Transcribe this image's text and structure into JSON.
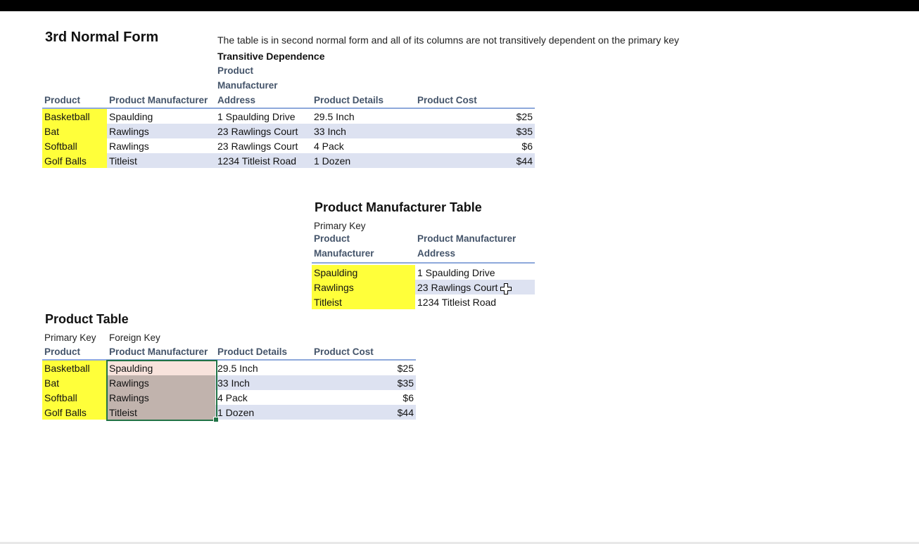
{
  "heading": {
    "title": "3rd Normal Form",
    "description": "The table is in second normal form and all of its columns are not transitively dependent on the primary key",
    "transitive_label": "Transitive Dependence",
    "transitive_col_line1": "Product",
    "transitive_col_line2": "Manufacturer"
  },
  "main_table": {
    "headers": [
      "Product",
      "Product Manufacturer",
      "Address",
      "Product Details",
      "Product Cost"
    ],
    "rows": [
      [
        "Basketball",
        "Spaulding",
        "1 Spaulding Drive",
        "29.5 Inch",
        "$25"
      ],
      [
        "Bat",
        "Rawlings",
        "23 Rawlings Court",
        "33 Inch",
        "$35"
      ],
      [
        "Softball",
        "Rawlings",
        "23 Rawlings Court",
        "4 Pack",
        "$6"
      ],
      [
        "Golf Balls",
        "Titleist",
        "1234 Titleist Road",
        "1 Dozen",
        "$44"
      ]
    ]
  },
  "manufacturer_table": {
    "title": "Product Manufacturer Table",
    "primary_key_label": "Primary Key",
    "headers_line1": [
      "Product",
      "Product Manufacturer"
    ],
    "headers_line2": [
      "Manufacturer",
      "Address"
    ],
    "rows": [
      [
        "Spaulding",
        "1 Spaulding Drive"
      ],
      [
        "Rawlings",
        "23 Rawlings Court"
      ],
      [
        "Titleist",
        "1234 Titleist Road"
      ]
    ]
  },
  "product_table": {
    "title": "Product Table",
    "primary_key_label": "Primary Key",
    "foreign_key_label": "Foreign Key",
    "headers": [
      "Product",
      "Product Manufacturer",
      "Product Details",
      "Product Cost"
    ],
    "rows": [
      [
        "Basketball",
        "Spaulding",
        "29.5 Inch",
        "$25"
      ],
      [
        "Bat",
        "Rawlings",
        "33 Inch",
        "$35"
      ],
      [
        "Softball",
        "Rawlings",
        "4 Pack",
        "$6"
      ],
      [
        "Golf Balls",
        "Titleist",
        "1 Dozen",
        "$44"
      ]
    ]
  },
  "colors": {
    "key_highlight": "#ffff3a",
    "band_row": "#dde2f1",
    "selection_border": "#217346",
    "selection_active": "#f8e3dc",
    "selection_range": "#c1b3ad"
  }
}
